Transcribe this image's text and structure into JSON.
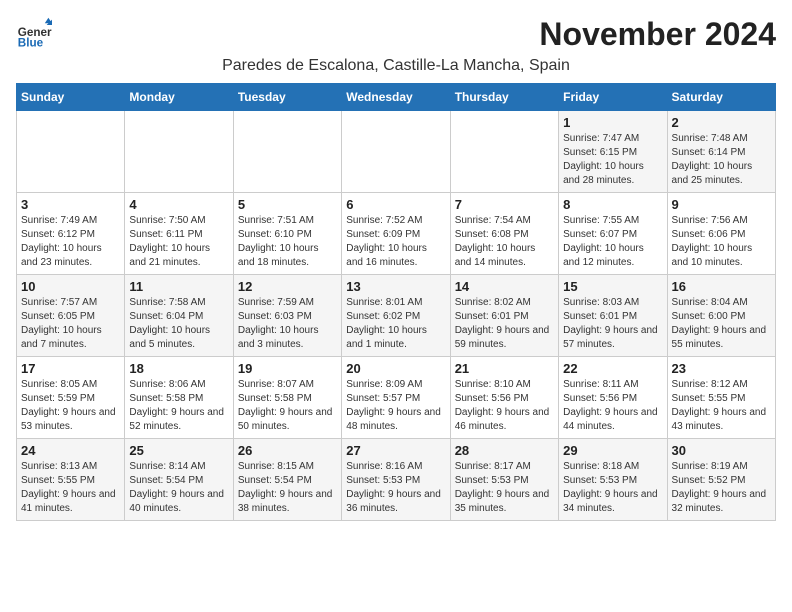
{
  "logo": {
    "general": "General",
    "blue": "Blue"
  },
  "title": "November 2024",
  "location": "Paredes de Escalona, Castille-La Mancha, Spain",
  "days_of_week": [
    "Sunday",
    "Monday",
    "Tuesday",
    "Wednesday",
    "Thursday",
    "Friday",
    "Saturday"
  ],
  "weeks": [
    [
      {
        "day": null
      },
      {
        "day": null
      },
      {
        "day": null
      },
      {
        "day": null
      },
      {
        "day": null
      },
      {
        "day": "1",
        "sunrise": "7:47 AM",
        "sunset": "6:15 PM",
        "daylight": "10 hours and 28 minutes."
      },
      {
        "day": "2",
        "sunrise": "7:48 AM",
        "sunset": "6:14 PM",
        "daylight": "10 hours and 25 minutes."
      }
    ],
    [
      {
        "day": "3",
        "sunrise": "7:49 AM",
        "sunset": "6:12 PM",
        "daylight": "10 hours and 23 minutes."
      },
      {
        "day": "4",
        "sunrise": "7:50 AM",
        "sunset": "6:11 PM",
        "daylight": "10 hours and 21 minutes."
      },
      {
        "day": "5",
        "sunrise": "7:51 AM",
        "sunset": "6:10 PM",
        "daylight": "10 hours and 18 minutes."
      },
      {
        "day": "6",
        "sunrise": "7:52 AM",
        "sunset": "6:09 PM",
        "daylight": "10 hours and 16 minutes."
      },
      {
        "day": "7",
        "sunrise": "7:54 AM",
        "sunset": "6:08 PM",
        "daylight": "10 hours and 14 minutes."
      },
      {
        "day": "8",
        "sunrise": "7:55 AM",
        "sunset": "6:07 PM",
        "daylight": "10 hours and 12 minutes."
      },
      {
        "day": "9",
        "sunrise": "7:56 AM",
        "sunset": "6:06 PM",
        "daylight": "10 hours and 10 minutes."
      }
    ],
    [
      {
        "day": "10",
        "sunrise": "7:57 AM",
        "sunset": "6:05 PM",
        "daylight": "10 hours and 7 minutes."
      },
      {
        "day": "11",
        "sunrise": "7:58 AM",
        "sunset": "6:04 PM",
        "daylight": "10 hours and 5 minutes."
      },
      {
        "day": "12",
        "sunrise": "7:59 AM",
        "sunset": "6:03 PM",
        "daylight": "10 hours and 3 minutes."
      },
      {
        "day": "13",
        "sunrise": "8:01 AM",
        "sunset": "6:02 PM",
        "daylight": "10 hours and 1 minute."
      },
      {
        "day": "14",
        "sunrise": "8:02 AM",
        "sunset": "6:01 PM",
        "daylight": "9 hours and 59 minutes."
      },
      {
        "day": "15",
        "sunrise": "8:03 AM",
        "sunset": "6:01 PM",
        "daylight": "9 hours and 57 minutes."
      },
      {
        "day": "16",
        "sunrise": "8:04 AM",
        "sunset": "6:00 PM",
        "daylight": "9 hours and 55 minutes."
      }
    ],
    [
      {
        "day": "17",
        "sunrise": "8:05 AM",
        "sunset": "5:59 PM",
        "daylight": "9 hours and 53 minutes."
      },
      {
        "day": "18",
        "sunrise": "8:06 AM",
        "sunset": "5:58 PM",
        "daylight": "9 hours and 52 minutes."
      },
      {
        "day": "19",
        "sunrise": "8:07 AM",
        "sunset": "5:58 PM",
        "daylight": "9 hours and 50 minutes."
      },
      {
        "day": "20",
        "sunrise": "8:09 AM",
        "sunset": "5:57 PM",
        "daylight": "9 hours and 48 minutes."
      },
      {
        "day": "21",
        "sunrise": "8:10 AM",
        "sunset": "5:56 PM",
        "daylight": "9 hours and 46 minutes."
      },
      {
        "day": "22",
        "sunrise": "8:11 AM",
        "sunset": "5:56 PM",
        "daylight": "9 hours and 44 minutes."
      },
      {
        "day": "23",
        "sunrise": "8:12 AM",
        "sunset": "5:55 PM",
        "daylight": "9 hours and 43 minutes."
      }
    ],
    [
      {
        "day": "24",
        "sunrise": "8:13 AM",
        "sunset": "5:55 PM",
        "daylight": "9 hours and 41 minutes."
      },
      {
        "day": "25",
        "sunrise": "8:14 AM",
        "sunset": "5:54 PM",
        "daylight": "9 hours and 40 minutes."
      },
      {
        "day": "26",
        "sunrise": "8:15 AM",
        "sunset": "5:54 PM",
        "daylight": "9 hours and 38 minutes."
      },
      {
        "day": "27",
        "sunrise": "8:16 AM",
        "sunset": "5:53 PM",
        "daylight": "9 hours and 36 minutes."
      },
      {
        "day": "28",
        "sunrise": "8:17 AM",
        "sunset": "5:53 PM",
        "daylight": "9 hours and 35 minutes."
      },
      {
        "day": "29",
        "sunrise": "8:18 AM",
        "sunset": "5:53 PM",
        "daylight": "9 hours and 34 minutes."
      },
      {
        "day": "30",
        "sunrise": "8:19 AM",
        "sunset": "5:52 PM",
        "daylight": "9 hours and 32 minutes."
      }
    ]
  ],
  "labels": {
    "sunrise": "Sunrise:",
    "sunset": "Sunset:",
    "daylight": "Daylight:"
  }
}
